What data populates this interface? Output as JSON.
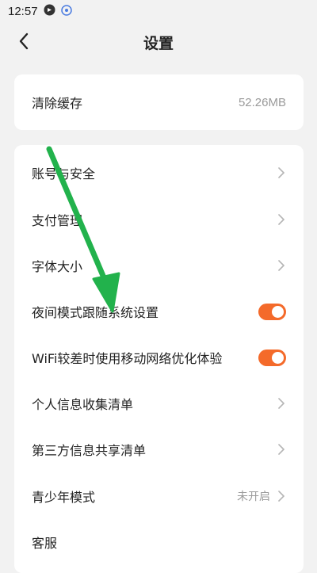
{
  "status_bar": {
    "time": "12:57"
  },
  "header": {
    "title": "设置",
    "back_icon": "chevron-left-icon"
  },
  "cache": {
    "label": "清除缓存",
    "value": "52.26MB"
  },
  "settings": {
    "items": [
      {
        "label": "账号与安全",
        "control": "chevron"
      },
      {
        "label": "支付管理",
        "control": "chevron"
      },
      {
        "label": "字体大小",
        "control": "chevron"
      },
      {
        "label": "夜间模式跟随系统设置",
        "control": "toggle",
        "on": true
      },
      {
        "label": "WiFi较差时使用移动网络优化体验",
        "control": "toggle",
        "on": true
      },
      {
        "label": "个人信息收集清单",
        "control": "chevron"
      },
      {
        "label": "第三方信息共享清单",
        "control": "chevron"
      },
      {
        "label": "青少年模式",
        "control": "chevron",
        "value": "未开启"
      },
      {
        "label": "客服",
        "control": "none"
      }
    ]
  },
  "colors": {
    "toggle_on": "#f46a2a",
    "annotation_arrow": "#22b24c",
    "background": "#f2f2f2"
  }
}
